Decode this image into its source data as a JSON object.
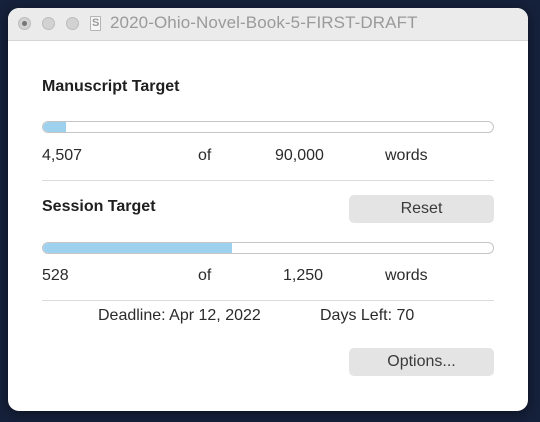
{
  "window": {
    "title": "2020-Ohio-Novel-Book-5-FIRST-DRAFT"
  },
  "manuscript": {
    "heading": "Manuscript Target",
    "current": "4,507",
    "of_label": "of",
    "target": "90,000",
    "unit": "words",
    "progress_fraction": 0.05
  },
  "session": {
    "heading": "Session Target",
    "reset_label": "Reset",
    "current": "528",
    "of_label": "of",
    "target": "1,250",
    "unit": "words",
    "progress_fraction": 0.42
  },
  "deadline": {
    "text": "Deadline: Apr 12, 2022",
    "days_left_text": "Days Left: 70"
  },
  "options_label": "Options...",
  "colors": {
    "progress_fill": "#9dd1ee",
    "desktop_background": "#15203a"
  }
}
